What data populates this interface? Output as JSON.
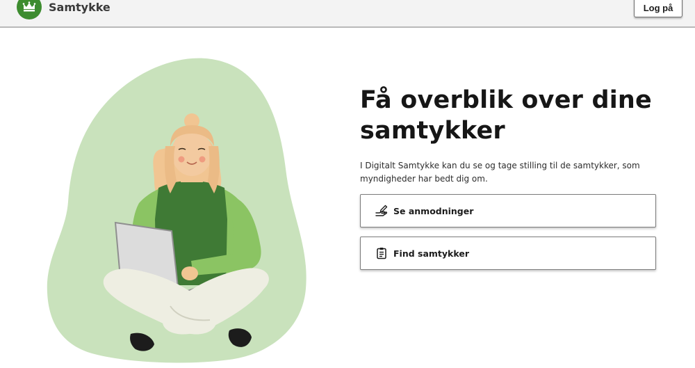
{
  "header": {
    "brand_name": "Samtykke",
    "login_label": "Log på",
    "brand_color": "#3d8c2f"
  },
  "hero": {
    "title": "Få overblik over dine samtykker",
    "description": "I Digitalt Samtykke kan du se og tage stilling til de samtykker, som myndigheder har bedt dig om."
  },
  "actions": [
    {
      "label": "Se anmodninger",
      "icon": "hand-pen-icon"
    },
    {
      "label": "Find samtykker",
      "icon": "clipboard-list-icon"
    }
  ],
  "illustration": {
    "subject": "woman-with-laptop",
    "blob_color": "#c9e2bc",
    "sweater_color": "#8bc463",
    "vest_color": "#3f7a35"
  }
}
